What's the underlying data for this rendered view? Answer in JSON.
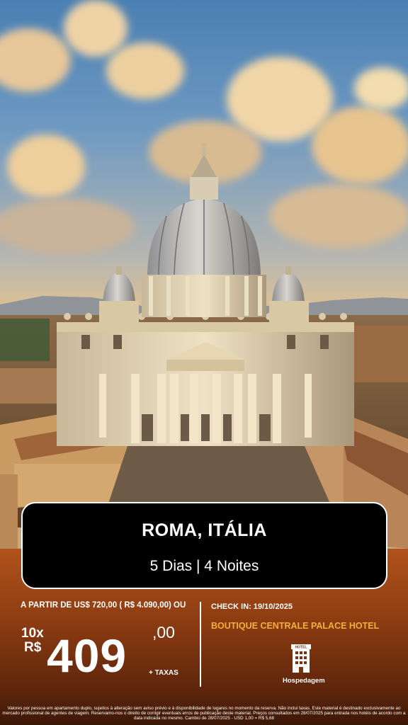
{
  "destination": "ROMA, ITÁLIA",
  "duration": "5 Dias | 4 Noites",
  "price": {
    "from_text": "A PARTIR DE US$ 720,00 ( R$ 4.090,00) OU",
    "installments": "10x",
    "currency": "R$",
    "amount": "409",
    "cents": ",00",
    "taxes": "+ TAXAS"
  },
  "check_in": "CHECK IN: 19/10/2025",
  "hotel_name": "BOUTIQUE CENTRALE PALACE HOTEL",
  "lodging": {
    "icon": "hotel-building-icon",
    "icon_text": "HOTEL",
    "label": "Hospedagem"
  },
  "disclaimer": "Valores por pessoa em apartamento duplo, sujeitos à alteração sem aviso prévio e à disponibilidade de lugares no momento da reserva. Não inclui taxas. Este material é destinado exclusivamente ao mercado profissional de agentes de viagem. Reservamo-nos o direito de corrigir eventuais erros de publicação deste material. Preços consultados em 28/07/2025 para entrada nos hotéis de acordo com a data indicada no mesmo. Cambio de 28/07/2025 - USD 1,00 = R$ 5,68",
  "colors": {
    "panel": "#8e3d12",
    "accent": "#f4ae3b",
    "card": "#000000",
    "text": "#ffffff"
  }
}
